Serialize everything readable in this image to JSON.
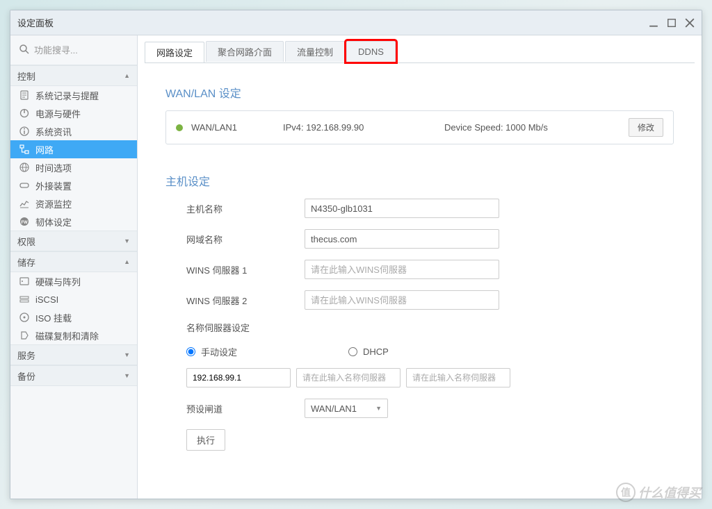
{
  "window": {
    "title": "设定面板"
  },
  "search": {
    "placeholder": "功能搜寻..."
  },
  "sidebar": {
    "sections": [
      {
        "title": "控制",
        "items": [
          {
            "label": "系统记录与提醒",
            "icon": "clipboard"
          },
          {
            "label": "电源与硬件",
            "icon": "power"
          },
          {
            "label": "系统资讯",
            "icon": "info"
          },
          {
            "label": "网路",
            "icon": "network",
            "active": true
          },
          {
            "label": "时间选项",
            "icon": "globe"
          },
          {
            "label": "外接装置",
            "icon": "usb"
          },
          {
            "label": "资源监控",
            "icon": "chart"
          },
          {
            "label": "韧体设定",
            "icon": "firmware"
          }
        ]
      },
      {
        "title": "权限",
        "collapsed": true,
        "items": []
      },
      {
        "title": "储存",
        "items": [
          {
            "label": "硬碟与阵列",
            "icon": "hdd"
          },
          {
            "label": "iSCSI",
            "icon": "iscsi"
          },
          {
            "label": "ISO 挂载",
            "icon": "iso"
          },
          {
            "label": "磁碟复制和清除",
            "icon": "clone"
          }
        ]
      },
      {
        "title": "服务",
        "collapsed": true,
        "items": []
      },
      {
        "title": "备份",
        "collapsed": true,
        "items": []
      }
    ]
  },
  "tabs": [
    {
      "label": "网路设定",
      "active": true
    },
    {
      "label": "聚合网路介面"
    },
    {
      "label": "流量控制"
    },
    {
      "label": "DDNS",
      "highlighted": true
    }
  ],
  "wanlan": {
    "title": "WAN/LAN 设定",
    "name": "WAN/LAN1",
    "ip_label": "IPv4: 192.168.99.90",
    "speed_label": "Device Speed: 1000 Mb/s",
    "modify_btn": "修改"
  },
  "host": {
    "title": "主机设定",
    "hostname_label": "主机名称",
    "hostname_value": "N4350-glb1031",
    "domain_label": "网域名称",
    "domain_value": "thecus.com",
    "wins1_label": "WINS 伺服器 1",
    "wins1_placeholder": "请在此输入WINS伺服器",
    "wins2_label": "WINS 伺服器 2",
    "wins2_placeholder": "请在此输入WINS伺服器",
    "ns_label": "名称伺服器设定",
    "manual_label": "手动设定",
    "dhcp_label": "DHCP",
    "ns1_value": "192.168.99.1",
    "ns2_placeholder": "请在此输入名称伺服器",
    "ns3_placeholder": "请在此输入名称伺服器",
    "gateway_label": "预设闸道",
    "gateway_value": "WAN/LAN1",
    "execute_btn": "执行"
  },
  "watermark": "什么值得买"
}
